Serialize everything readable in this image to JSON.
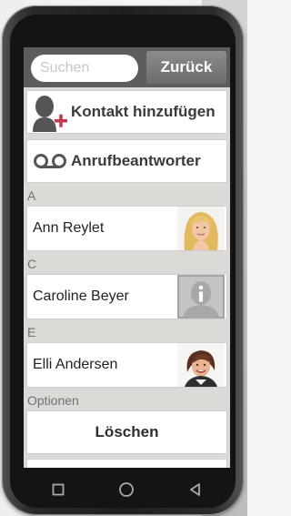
{
  "search": {
    "placeholder": "Suchen"
  },
  "toolbar": {
    "back_label": "Zurück"
  },
  "actions": [
    {
      "label": "Kontakt hinzufügen",
      "icon": "add-contact-icon"
    },
    {
      "label": "Anrufbeantworter",
      "icon": "voicemail-icon"
    }
  ],
  "sections": [
    {
      "letter": "A",
      "contacts": [
        {
          "name": "Ann Reylet",
          "avatar": "photo"
        }
      ]
    },
    {
      "letter": "C",
      "contacts": [
        {
          "name": "Caroline Beyer",
          "avatar": "placeholder"
        }
      ]
    },
    {
      "letter": "E",
      "contacts": [
        {
          "name": "Elli Andersen",
          "avatar": "photo"
        }
      ]
    }
  ],
  "options": {
    "title": "Optionen",
    "delete_label": "Löschen"
  },
  "navbar": {
    "icons": [
      "square-icon",
      "circle-icon",
      "back-triangle-icon"
    ]
  },
  "colors": {
    "header": "#5d5d5d",
    "add_accent": "#c8354e",
    "list_bg": "#dcdad7"
  }
}
